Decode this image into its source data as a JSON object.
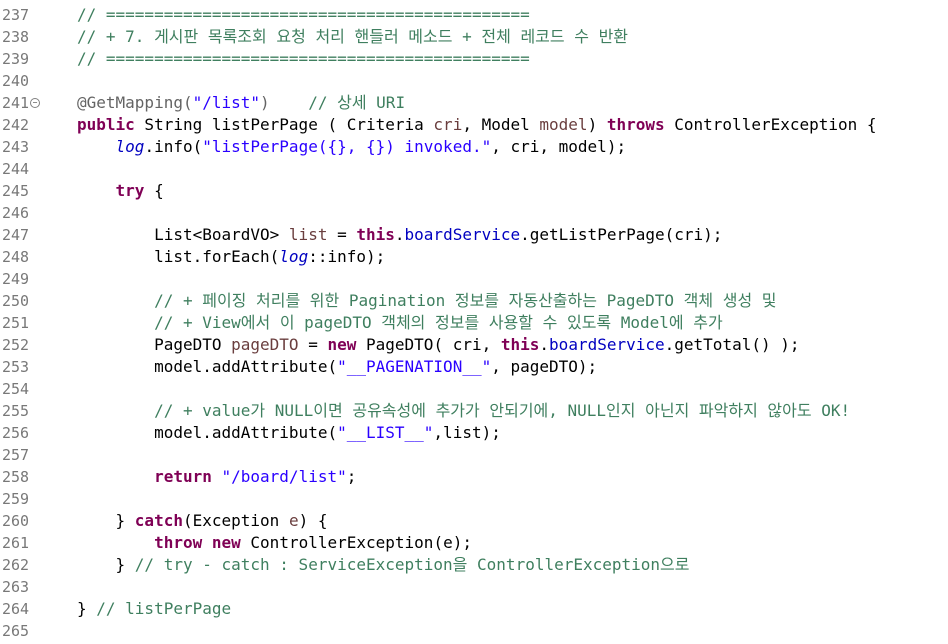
{
  "editor": {
    "colors": {
      "keyword": "#7f0055",
      "string": "#2a00ff",
      "comment": "#3f7f5f",
      "annotation": "#646464",
      "field": "#0000c0",
      "local_variable": "#6a3e3e",
      "line_number": "#787878"
    },
    "lines": [
      {
        "n": "237",
        "tokens": [
          {
            "t": "    // ============================================",
            "c": "com"
          }
        ]
      },
      {
        "n": "238",
        "tokens": [
          {
            "t": "    // + 7. 게시판 목록조회 요청 처리 핸들러 메소드 + 전체 레코드 수 반환",
            "c": "com"
          }
        ]
      },
      {
        "n": "239",
        "tokens": [
          {
            "t": "    // ============================================",
            "c": "com"
          }
        ]
      },
      {
        "n": "240",
        "tokens": []
      },
      {
        "n": "241",
        "fold": true,
        "tokens": [
          {
            "t": "    @GetMapping(",
            "c": "ann"
          },
          {
            "t": "\"/list\"",
            "c": "str"
          },
          {
            "t": ")    ",
            "c": "ann"
          },
          {
            "t": "// 상세 URI",
            "c": "com"
          }
        ]
      },
      {
        "n": "242",
        "tokens": [
          {
            "t": "    ",
            "c": ""
          },
          {
            "t": "public",
            "c": "kw"
          },
          {
            "t": " String listPerPage ( Criteria ",
            "c": ""
          },
          {
            "t": "cri",
            "c": "var"
          },
          {
            "t": ", Model ",
            "c": ""
          },
          {
            "t": "model",
            "c": "var"
          },
          {
            "t": ") ",
            "c": ""
          },
          {
            "t": "throws",
            "c": "kw"
          },
          {
            "t": " ControllerException {",
            "c": ""
          }
        ]
      },
      {
        "n": "243",
        "tokens": [
          {
            "t": "        ",
            "c": ""
          },
          {
            "t": "log",
            "c": "sfld"
          },
          {
            "t": ".info(",
            "c": ""
          },
          {
            "t": "\"listPerPage({}, {}) invoked.\"",
            "c": "str"
          },
          {
            "t": ", cri, model);",
            "c": ""
          }
        ]
      },
      {
        "n": "244",
        "tokens": []
      },
      {
        "n": "245",
        "tokens": [
          {
            "t": "        ",
            "c": ""
          },
          {
            "t": "try",
            "c": "kw"
          },
          {
            "t": " {",
            "c": ""
          }
        ]
      },
      {
        "n": "246",
        "tokens": []
      },
      {
        "n": "247",
        "tokens": [
          {
            "t": "            List<BoardVO> ",
            "c": ""
          },
          {
            "t": "list",
            "c": "var"
          },
          {
            "t": " = ",
            "c": ""
          },
          {
            "t": "this",
            "c": "kw"
          },
          {
            "t": ".",
            "c": ""
          },
          {
            "t": "boardService",
            "c": "fld"
          },
          {
            "t": ".getListPerPage(cri);",
            "c": ""
          }
        ]
      },
      {
        "n": "248",
        "tokens": [
          {
            "t": "            list.forEach(",
            "c": ""
          },
          {
            "t": "log",
            "c": "sfld"
          },
          {
            "t": "::info);",
            "c": ""
          }
        ]
      },
      {
        "n": "249",
        "tokens": []
      },
      {
        "n": "250",
        "tokens": [
          {
            "t": "            // + 페이징 처리를 위한 Pagination 정보를 자동산출하는 PageDTO 객체 생성 및",
            "c": "com"
          }
        ]
      },
      {
        "n": "251",
        "tokens": [
          {
            "t": "            // + View에서 이 pageDTO 객체의 정보를 사용할 수 있도록 Model에 추가",
            "c": "com"
          }
        ]
      },
      {
        "n": "252",
        "tokens": [
          {
            "t": "            PageDTO ",
            "c": ""
          },
          {
            "t": "pageDTO",
            "c": "var"
          },
          {
            "t": " = ",
            "c": ""
          },
          {
            "t": "new",
            "c": "kw"
          },
          {
            "t": " PageDTO( cri, ",
            "c": ""
          },
          {
            "t": "this",
            "c": "kw"
          },
          {
            "t": ".",
            "c": ""
          },
          {
            "t": "boardService",
            "c": "fld"
          },
          {
            "t": ".getTotal() );",
            "c": ""
          }
        ]
      },
      {
        "n": "253",
        "tokens": [
          {
            "t": "            model.addAttribute(",
            "c": ""
          },
          {
            "t": "\"__PAGENATION__\"",
            "c": "str"
          },
          {
            "t": ", pageDTO);",
            "c": ""
          }
        ]
      },
      {
        "n": "254",
        "tokens": []
      },
      {
        "n": "255",
        "tokens": [
          {
            "t": "            // + value가 NULL이면 공유속성에 추가가 안되기에, NULL인지 아닌지 파악하지 않아도 OK!",
            "c": "com"
          }
        ]
      },
      {
        "n": "256",
        "tokens": [
          {
            "t": "            model.addAttribute(",
            "c": ""
          },
          {
            "t": "\"__LIST__\"",
            "c": "str"
          },
          {
            "t": ",list);",
            "c": ""
          }
        ]
      },
      {
        "n": "257",
        "tokens": []
      },
      {
        "n": "258",
        "tokens": [
          {
            "t": "            ",
            "c": ""
          },
          {
            "t": "return",
            "c": "kw"
          },
          {
            "t": " ",
            "c": ""
          },
          {
            "t": "\"/board/list\"",
            "c": "str"
          },
          {
            "t": ";",
            "c": ""
          }
        ]
      },
      {
        "n": "259",
        "tokens": []
      },
      {
        "n": "260",
        "tokens": [
          {
            "t": "        } ",
            "c": ""
          },
          {
            "t": "catch",
            "c": "kw"
          },
          {
            "t": "(Exception ",
            "c": ""
          },
          {
            "t": "e",
            "c": "var"
          },
          {
            "t": ") {",
            "c": ""
          }
        ]
      },
      {
        "n": "261",
        "tokens": [
          {
            "t": "            ",
            "c": ""
          },
          {
            "t": "throw",
            "c": "kw"
          },
          {
            "t": " ",
            "c": ""
          },
          {
            "t": "new",
            "c": "kw"
          },
          {
            "t": " ControllerException(e);",
            "c": ""
          }
        ]
      },
      {
        "n": "262",
        "tokens": [
          {
            "t": "        } ",
            "c": ""
          },
          {
            "t": "// try - catch : ServiceException을 ControllerException으로",
            "c": "com"
          }
        ]
      },
      {
        "n": "263",
        "tokens": []
      },
      {
        "n": "264",
        "tokens": [
          {
            "t": "    } ",
            "c": ""
          },
          {
            "t": "// listPerPage",
            "c": "com"
          }
        ]
      },
      {
        "n": "265",
        "tokens": []
      }
    ]
  }
}
